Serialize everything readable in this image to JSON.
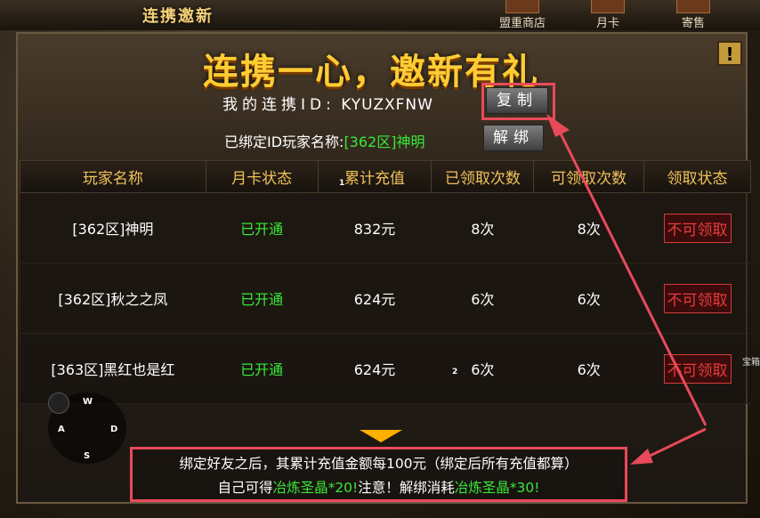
{
  "window": {
    "tab_title": "连携邀新"
  },
  "top_nav": [
    {
      "label": "盟重商店"
    },
    {
      "label": "月卡"
    },
    {
      "label": "寄售"
    }
  ],
  "banner": {
    "title": "连携一心，邀新有礼",
    "help_icon_label": "!"
  },
  "invite": {
    "id_label": "我的连携ID:",
    "id_value": "KYUZXFNW",
    "copy_button": "复制",
    "bound_label": "已绑定ID玩家名称:",
    "bound_name": "[362区]神明",
    "unbind_button": "解绑"
  },
  "table": {
    "headers": [
      "玩家名称",
      "月卡状态",
      "累计充值",
      "已领取次数",
      "可领取次数",
      "领取状态"
    ],
    "rows": [
      {
        "name": "[362区]神明",
        "card": "已开通",
        "recharge": "832元",
        "claimed": "8次",
        "available": "8次",
        "status": "不可领取"
      },
      {
        "name": "[362区]秋之之凤",
        "card": "已开通",
        "recharge": "624元",
        "claimed": "6次",
        "available": "6次",
        "status": "不可领取"
      },
      {
        "name": "[363区]黑红也是红",
        "card": "已开通",
        "recharge": "624元",
        "claimed": "6次",
        "available": "6次",
        "status": "不可领取"
      }
    ]
  },
  "note": {
    "line1": "绑定好友之后，其累计充值金额每100元（绑定后所有充值都算）",
    "line2_a": "自己可得",
    "line2_b": "冶炼圣晶*20!",
    "line2_c": "注意！解绑消耗",
    "line2_d": "冶炼圣晶*30!"
  },
  "dpad": {
    "up": "W",
    "left": "A",
    "right": "D",
    "down": "S"
  },
  "markers": {
    "m1": "1",
    "m2": "2"
  },
  "side_text": "宝箱",
  "colors": {
    "highlight": "#e84a5a",
    "gold": "#ffcc33",
    "green": "#38e838",
    "status_red": "#e83a3a"
  }
}
